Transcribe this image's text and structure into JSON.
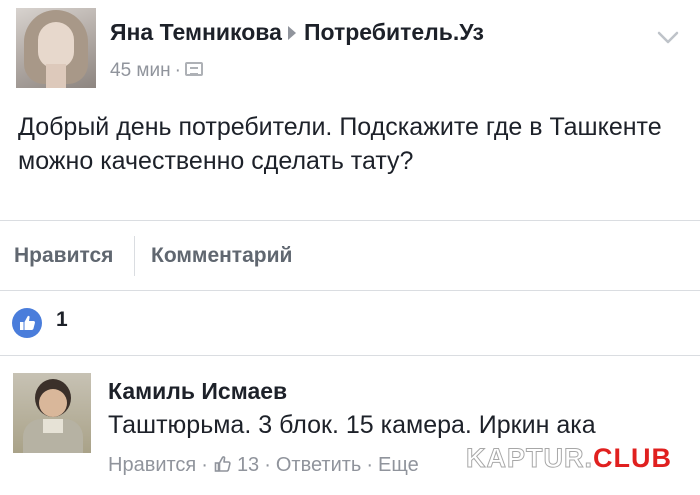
{
  "post": {
    "author": "Яна Темникова",
    "group": "Потребитель.Уз",
    "time": "45 мин",
    "meta_sep": "·",
    "text": "Добрый день потребители. Подскажите где в Ташкенте можно качественно сделать тату?"
  },
  "actions": {
    "like_label": "Нравится",
    "comment_label": "Комментарий"
  },
  "reactions": {
    "like_count": "1"
  },
  "comment": {
    "author": "Камиль Исмаев",
    "text": "Таштюрьма. 3 блок. 15 камера. Иркин ака",
    "like_label": "Нравится",
    "like_count": "13",
    "reply_label": "Ответить",
    "more_label": "Еще",
    "sep": "·"
  },
  "watermark": {
    "prefix": "KAPTUR.",
    "suffix": "CLUB"
  },
  "colors": {
    "link_blue": "#4a7ddb",
    "secondary_text": "#90949c",
    "watermark_red": "#e0201f"
  },
  "icons": {
    "audience": "public-audience-icon",
    "chevron": "chevron-down-icon",
    "like": "like-thumb-icon"
  }
}
